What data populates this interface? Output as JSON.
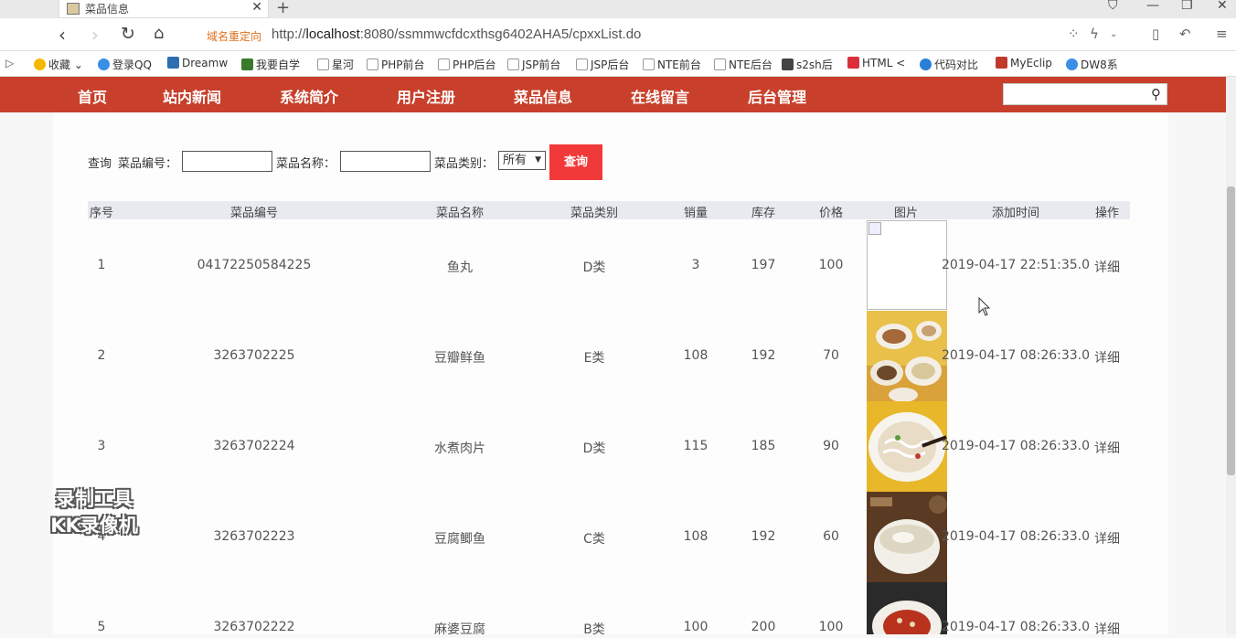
{
  "browser": {
    "tab_title": "菜品信息",
    "tab_close": "✕",
    "new_tab": "+",
    "redirect_label": "域名重定向",
    "url_prefix": "http://",
    "url_host": "localhost",
    "url_rest": ":8080/ssmmwcfdcxthsg6402AHA5/cpxxList.do"
  },
  "bookmarks": [
    {
      "label": "收藏",
      "color": "#f5b800"
    },
    {
      "label": "登录QQ",
      "color": "#3a8ee6"
    },
    {
      "label": "Dreamw",
      "color": "#2d6fb0"
    },
    {
      "label": "我要自学",
      "color": "#3b7a2a"
    },
    {
      "label": "星河",
      "color": "#bbbbbb"
    },
    {
      "label": "PHP前台",
      "color": "#bbbbbb"
    },
    {
      "label": "PHP后台",
      "color": "#bbbbbb"
    },
    {
      "label": "JSP前台",
      "color": "#bbbbbb"
    },
    {
      "label": "JSP后台",
      "color": "#bbbbbb"
    },
    {
      "label": "NTE前台",
      "color": "#bbbbbb"
    },
    {
      "label": "NTE后台",
      "color": "#bbbbbb"
    },
    {
      "label": "s2sh后",
      "color": "#444444"
    },
    {
      "label": "HTML <",
      "color": "#d9303a"
    },
    {
      "label": "代码对比",
      "color": "#2a7fd8"
    },
    {
      "label": "MyEclip",
      "color": "#c0392b"
    },
    {
      "label": "DW8系",
      "color": "#3a8ee6"
    }
  ],
  "nav": {
    "items": [
      "首页",
      "站内新闻",
      "系统简介",
      "用户注册",
      "菜品信息",
      "在线留言",
      "后台管理"
    ],
    "search_value": ""
  },
  "query": {
    "label_query": "查询",
    "label_code": "菜品编号：",
    "label_name": "菜品名称：",
    "label_category": "菜品类别：",
    "code_value": "",
    "name_value": "",
    "category_selected": "所有",
    "button": "查询"
  },
  "table": {
    "headers": [
      "序号",
      "菜品编号",
      "菜品名称",
      "菜品类别",
      "销量",
      "库存",
      "价格",
      "图片",
      "添加时间",
      "操作"
    ],
    "rows": [
      {
        "no": "1",
        "code": "04172250584225",
        "name": "鱼丸",
        "category": "D类",
        "sales": "3",
        "stock": "197",
        "price": "100",
        "time": "2019-04-17 22:51:35.0",
        "action": "详细"
      },
      {
        "no": "2",
        "code": "3263702225",
        "name": "豆瓣鲜鱼",
        "category": "E类",
        "sales": "108",
        "stock": "192",
        "price": "70",
        "time": "2019-04-17 08:26:33.0",
        "action": "详细"
      },
      {
        "no": "3",
        "code": "3263702224",
        "name": "水煮肉片",
        "category": "D类",
        "sales": "115",
        "stock": "185",
        "price": "90",
        "time": "2019-04-17 08:26:33.0",
        "action": "详细"
      },
      {
        "no": "4",
        "code": "3263702223",
        "name": "豆腐鲫鱼",
        "category": "C类",
        "sales": "108",
        "stock": "192",
        "price": "60",
        "time": "2019-04-17 08:26:33.0",
        "action": "详细"
      },
      {
        "no": "5",
        "code": "3263702222",
        "name": "麻婆豆腐",
        "category": "B类",
        "sales": "100",
        "stock": "200",
        "price": "100",
        "time": "2019-04-17 08:26:33.0",
        "action": "详细"
      }
    ]
  },
  "watermark": {
    "line1": "录制工具",
    "line2": "KK录像机"
  },
  "colors": {
    "nav_bg": "#c8402b",
    "query_button": "#f2393a",
    "table_header_bg": "#e8eaf0"
  }
}
